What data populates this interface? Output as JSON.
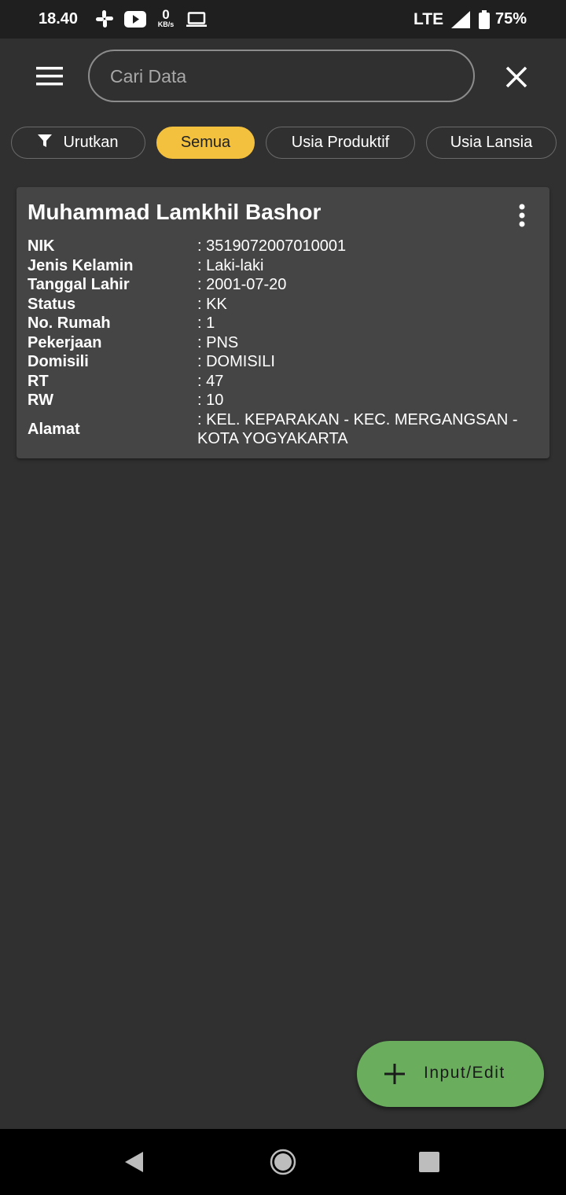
{
  "status_bar": {
    "time": "18.40",
    "data_speed_value": "0",
    "data_speed_unit": "KB/s",
    "network": "LTE",
    "battery": "75%",
    "icons": [
      "slack-icon",
      "youtube-icon",
      "laptop-icon",
      "signal-icon",
      "battery-icon"
    ]
  },
  "search": {
    "placeholder": "Cari Data",
    "value": ""
  },
  "filters": {
    "sort_label": "Urutkan",
    "chips": [
      "Semua",
      "Usia Produktif",
      "Usia Lansia"
    ],
    "active": "Semua"
  },
  "record": {
    "name": "Muhammad Lamkhil Bashor",
    "fields": [
      {
        "label": "NIK",
        "value": ": 3519072007010001"
      },
      {
        "label": "Jenis Kelamin",
        "value": ": Laki-laki"
      },
      {
        "label": "Tanggal Lahir",
        "value": ": 2001-07-20"
      },
      {
        "label": "Status",
        "value": ": KK"
      },
      {
        "label": "No. Rumah",
        "value": ": 1"
      },
      {
        "label": "Pekerjaan",
        "value": ": PNS"
      },
      {
        "label": "Domisili",
        "value": ": DOMISILI"
      },
      {
        "label": "RT",
        "value": ": 47"
      },
      {
        "label": "RW",
        "value": ": 10"
      },
      {
        "label": "Alamat",
        "value": ": KEL. KEPARAKAN - KEC. MERGANGSAN - KOTA YOGYAKARTA"
      }
    ]
  },
  "fab": {
    "label": "Input/Edit"
  },
  "colors": {
    "background": "#303030",
    "card": "#454545",
    "accent_chip": "#f4c13e",
    "fab": "#69ad5d"
  }
}
